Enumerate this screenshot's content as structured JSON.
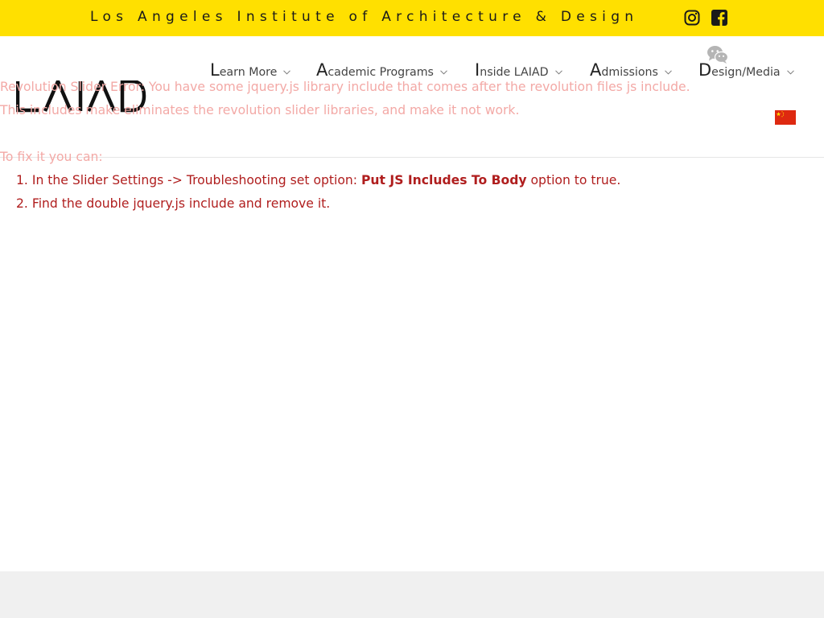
{
  "topbar": {
    "title": "Los Angeles Institute of Architecture & Design",
    "instagram_icon": "instagram-icon",
    "facebook_icon": "facebook-icon",
    "background": "#ffe000"
  },
  "header": {
    "logo_text": "LAIAD",
    "nav": [
      {
        "first": "L",
        "rest": "earn More"
      },
      {
        "first": "A",
        "rest": "cademic Programs"
      },
      {
        "first": "I",
        "rest": "nside LAIAD"
      },
      {
        "first": "A",
        "rest": "dmissions"
      },
      {
        "first": "D",
        "rest": "esign/Media"
      }
    ],
    "wechat_icon": "wechat-icon",
    "flag_icon": "china-flag-icon"
  },
  "error": {
    "line1": "Revolution Slider Error: You have some jquery.js library include that comes after the revolution files js include.",
    "line2": "This includes make eliminates the revolution slider libraries, and make it not work.",
    "fix_intro": "To fix it you can:",
    "step1_num": "1.",
    "step1_pre": "In the Slider Settings -> Troubleshooting set option:",
    "step1_bold": "Put JS Includes To Body",
    "step1_post": "option to true.",
    "step2_num": "2.",
    "step2": "Find the double jquery.js include and remove it.",
    "color_faded": "#f3a9a6",
    "color_strong": "#b01e1e"
  }
}
